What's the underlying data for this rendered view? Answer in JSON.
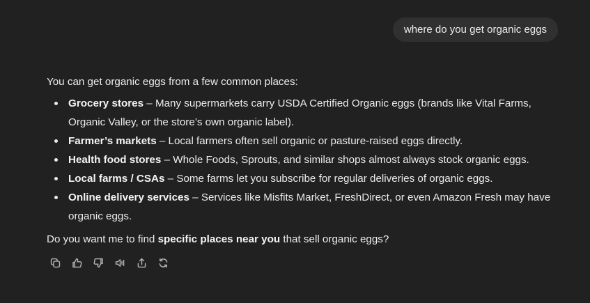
{
  "user_message": "where do you get organic eggs",
  "response": {
    "intro": "You can get organic eggs from a few common places:",
    "items": [
      {
        "title": "Grocery stores",
        "sep": " – ",
        "text": "Many supermarkets carry USDA Certified Organic eggs (brands like Vital Farms, Organic Valley, or the store’s own organic label)."
      },
      {
        "title": "Farmer’s markets",
        "sep": " – ",
        "text": "Local farmers often sell organic or pasture-raised eggs directly."
      },
      {
        "title": "Health food stores",
        "sep": " – ",
        "text": "Whole Foods, Sprouts, and similar shops almost always stock organic eggs."
      },
      {
        "title": "Local farms / CSAs",
        "sep": " – ",
        "text": "Some farms let you subscribe for regular deliveries of organic eggs."
      },
      {
        "title": "Online delivery services",
        "sep": " – ",
        "text": "Services like Misfits Market, FreshDirect, or even Amazon Fresh may have organic eggs."
      }
    ],
    "question_prefix": "Do you want me to find ",
    "question_bold": "specific places near you",
    "question_suffix": " that sell organic eggs?"
  },
  "actions": [
    {
      "name": "copy-icon"
    },
    {
      "name": "thumbs-up-icon"
    },
    {
      "name": "thumbs-down-icon"
    },
    {
      "name": "read-aloud-icon"
    },
    {
      "name": "share-icon"
    },
    {
      "name": "regenerate-icon"
    }
  ],
  "colors": {
    "background": "#212121",
    "bubble": "#303030",
    "text": "#ececec",
    "icon": "#b4b4b4"
  }
}
